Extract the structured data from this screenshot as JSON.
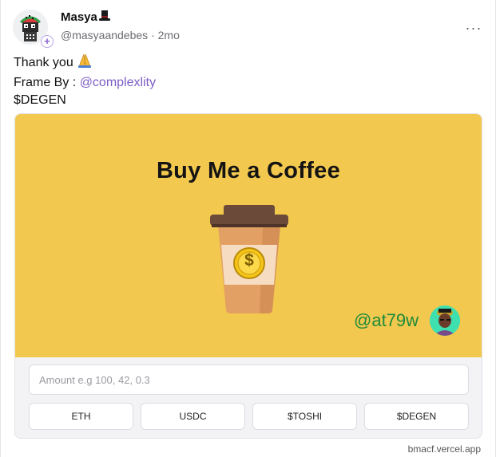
{
  "author": {
    "display_name": "Masya",
    "name_emoji_icon": "top-hat-icon",
    "handle": "@masyaandebes",
    "separator": "·",
    "time_ago": "2mo",
    "avatar_icon": "pixel-watermelon-avatar",
    "follow_badge": "+"
  },
  "menu": {
    "more_label": "···"
  },
  "post": {
    "line1": "Thank you",
    "line1_emoji_icon": "folded-hands-icon",
    "line2_prefix": "Frame By : ",
    "line2_mention": "@complexlity",
    "line3": "$DEGEN"
  },
  "frame": {
    "title": "Buy Me a Coffee",
    "creator_handle": "@at79w",
    "coin_symbol": "$",
    "amount_placeholder": "Amount e.g 100, 42, 0.3",
    "buttons": [
      "ETH",
      "USDC",
      "$TOSHI",
      "$DEGEN"
    ],
    "domain": "bmacf.vercel.app",
    "colors": {
      "background": "#f2c84e",
      "cup_lid": "#6b4a3a",
      "cup_body": "#e3a064",
      "coin": "#f5c518",
      "creator_handle": "#1e8a3a"
    }
  },
  "colors": {
    "mention": "#7c5cc4",
    "muted_text": "#6b6b72"
  }
}
